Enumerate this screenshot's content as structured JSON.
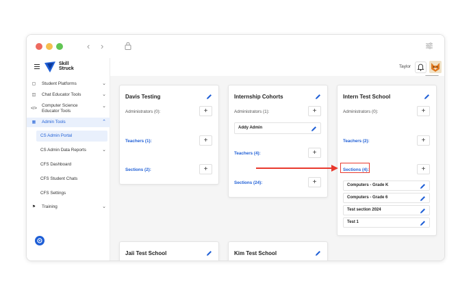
{
  "sidebar": {
    "logo": {
      "line1": "Skill",
      "line2": "Struck"
    },
    "items": [
      {
        "label": "Student Platforms",
        "icon": "window-icon"
      },
      {
        "label": "Chat Educator Tools",
        "icon": "chat-icon"
      },
      {
        "label": "Computer Science Educator Tools",
        "icon": "code-icon"
      },
      {
        "label": "Admin Tools",
        "icon": "building-icon"
      }
    ],
    "admin_sub": [
      {
        "label": "CS Admin Portal"
      },
      {
        "label": "CS Admin Data Reports"
      },
      {
        "label": "CFS Dashboard"
      },
      {
        "label": "CFS Student Chats"
      },
      {
        "label": "CFS Settings"
      }
    ],
    "training": {
      "label": "Training",
      "icon": "training-icon"
    }
  },
  "topbar": {
    "user_name": "Taylor"
  },
  "cards": [
    {
      "title": "Davis Testing",
      "administrators": "Administrators (0):",
      "teachers": "Teachers (1):",
      "sections": "Sections (2):"
    },
    {
      "title": "Internship Cohorts",
      "administrators": "Administrators (1):",
      "admin_entry": "Addy Admin",
      "teachers": "Teachers (4):",
      "sections": "Sections (24):"
    },
    {
      "title": "Intern Test School",
      "administrators": "Administrators (0):",
      "teachers": "Teachers (2):",
      "sections": "Sections (4):",
      "section_list": [
        "Computers - Grade K",
        "Computers - Grade 6",
        "Test section 2024",
        "Test 1"
      ]
    },
    {
      "title": "Jaii Test School"
    },
    {
      "title": "Kim Test School"
    }
  ],
  "colors": {
    "accent": "#1f5fd6",
    "annotation": "#e8372b"
  }
}
